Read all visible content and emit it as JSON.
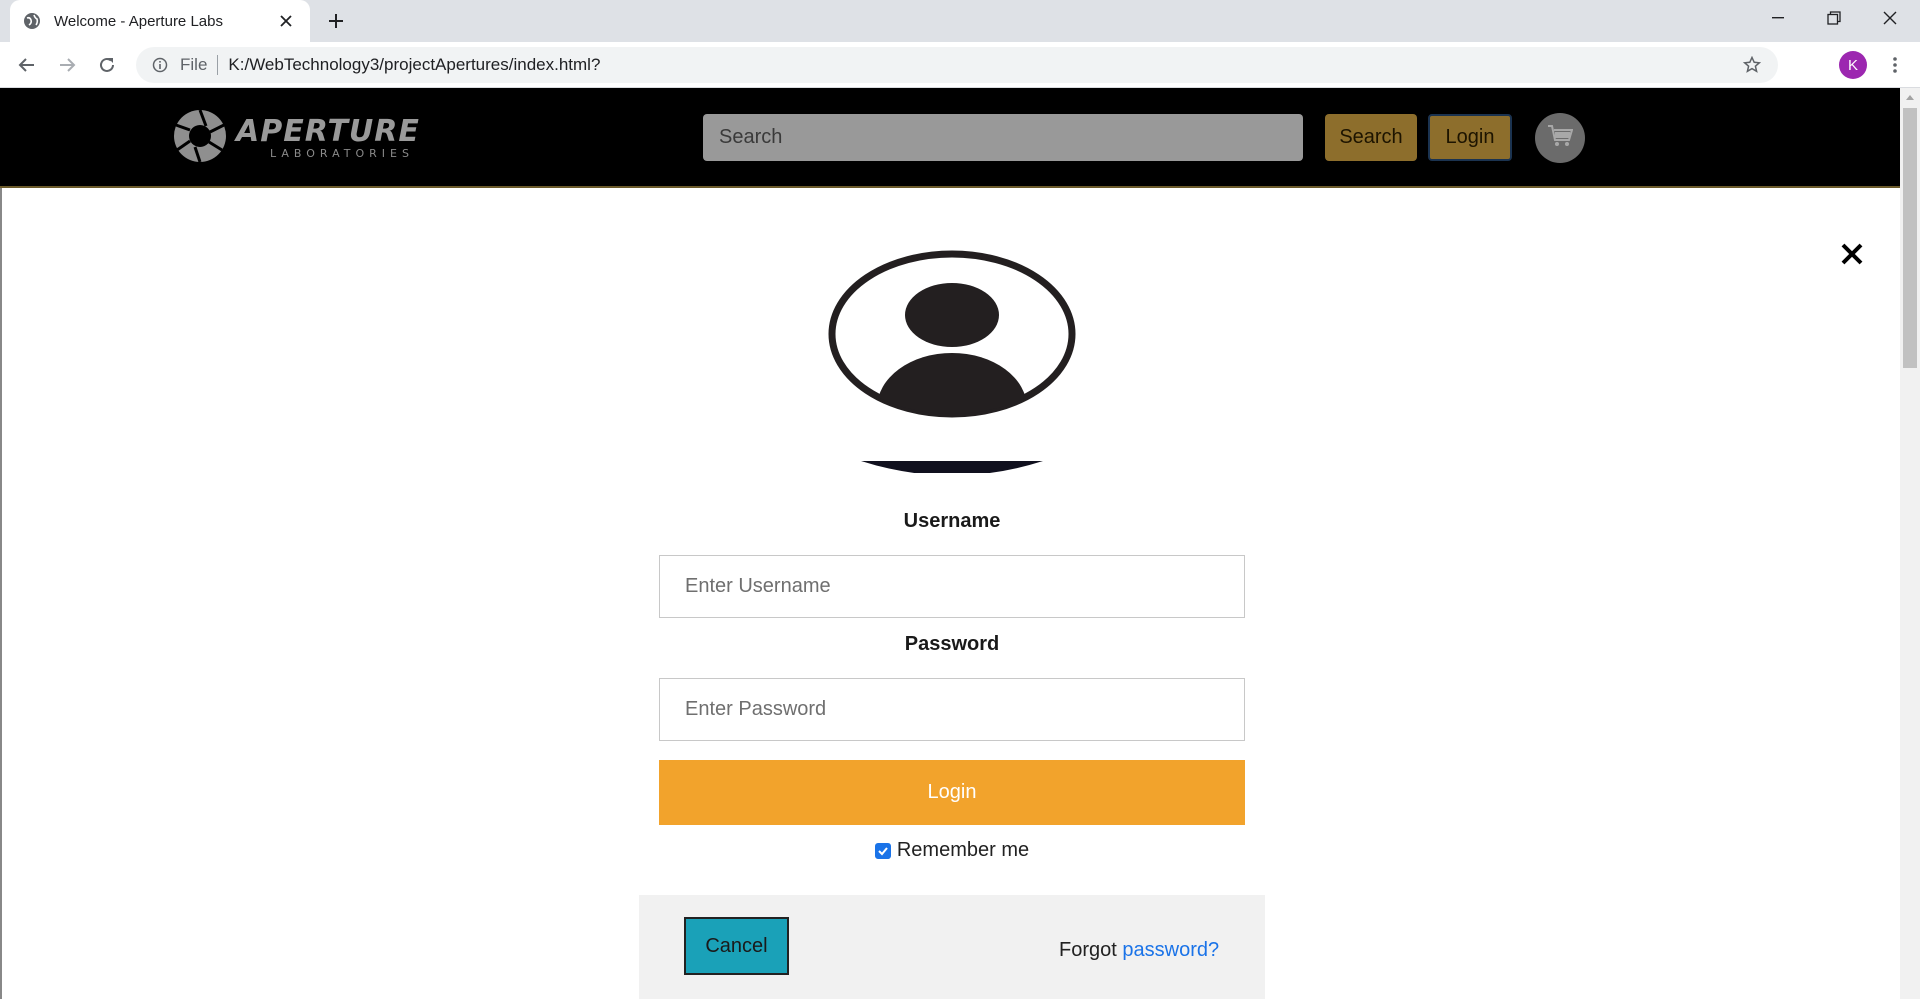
{
  "browser": {
    "tab_title": "Welcome - Aperture Labs",
    "url_scheme_label": "File",
    "url": "K:/WebTechnology3/projectApertures/index.html?",
    "profile_initial": "K"
  },
  "header": {
    "logo_main": "APERTURE",
    "logo_sub": "LABORATORIES",
    "search_placeholder": "Search",
    "search_button": "Search",
    "login_button": "Login"
  },
  "login_modal": {
    "username_label": "Username",
    "username_placeholder": "Enter Username",
    "password_label": "Password",
    "password_placeholder": "Enter Password",
    "submit_label": "Login",
    "remember_label": "Remember me",
    "remember_checked": true,
    "cancel_label": "Cancel",
    "forgot_text": "Forgot",
    "forgot_link": "password?"
  },
  "colors": {
    "header_bg": "#000000",
    "header_button": "#8d6e2c",
    "login_submit": "#f2a32c",
    "cancel_button": "#1aa1b8",
    "link": "#1a73e8"
  },
  "icons": [
    "globe-icon",
    "close-icon",
    "plus-icon",
    "back-arrow-icon",
    "forward-arrow-icon",
    "reload-icon",
    "info-icon",
    "star-icon",
    "kebab-menu-icon",
    "aperture-logo-icon",
    "cart-icon",
    "user-avatar-icon",
    "checkbox-checked-icon"
  ]
}
